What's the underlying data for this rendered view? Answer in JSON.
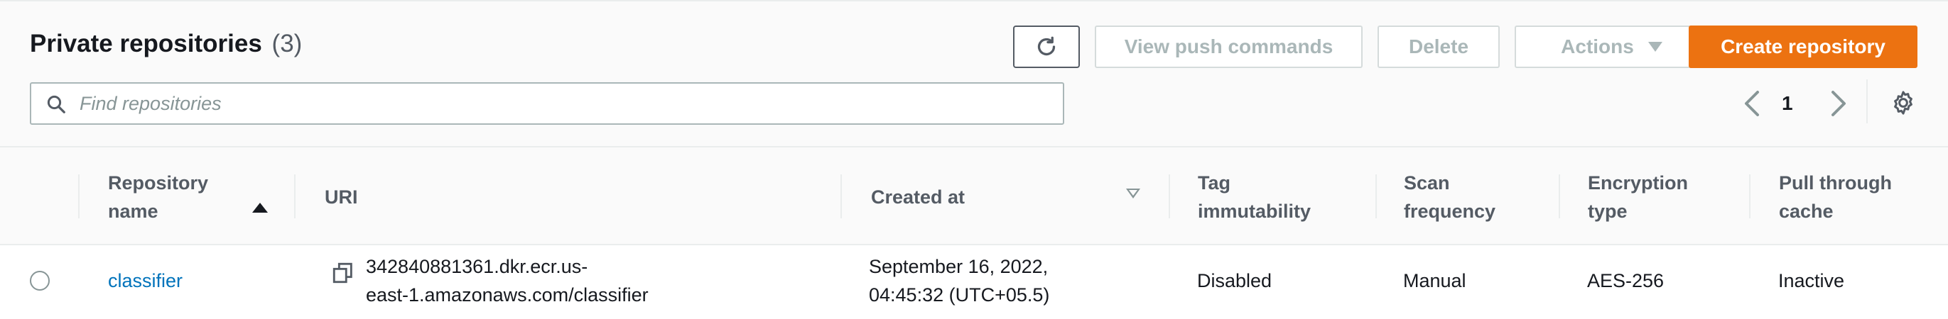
{
  "header": {
    "title": "Private repositories",
    "count": "(3)"
  },
  "toolbar": {
    "refresh_icon": "refresh-icon",
    "view_push_commands_label": "View push commands",
    "delete_label": "Delete",
    "actions_label": "Actions",
    "create_label": "Create repository"
  },
  "search": {
    "placeholder": "Find repositories",
    "value": ""
  },
  "pagination": {
    "current_page": "1"
  },
  "table": {
    "columns": {
      "repo_name_line1": "Repository",
      "repo_name_line2": "name",
      "uri": "URI",
      "created_at": "Created at",
      "tag_immutability_line1": "Tag",
      "tag_immutability_line2": "immutability",
      "scan_frequency_line1": "Scan",
      "scan_frequency_line2": "frequency",
      "encryption_line1": "Encryption",
      "encryption_line2": "type",
      "pull_through_line1": "Pull through",
      "pull_through_line2": "cache"
    },
    "rows": [
      {
        "name": "classifier",
        "uri_line1": "342840881361.dkr.ecr.us-",
        "uri_line2": "east-1.amazonaws.com/classifier",
        "created_line1": "September 16, 2022,",
        "created_line2": "04:45:32 (UTC+05.5)",
        "tag_immutability": "Disabled",
        "scan_frequency": "Manual",
        "encryption": "AES-256",
        "pull_through_cache": "Inactive"
      }
    ]
  },
  "colors": {
    "primary_button": "#ec7211",
    "link": "#0073bb",
    "disabled_text": "#aab7b8"
  }
}
